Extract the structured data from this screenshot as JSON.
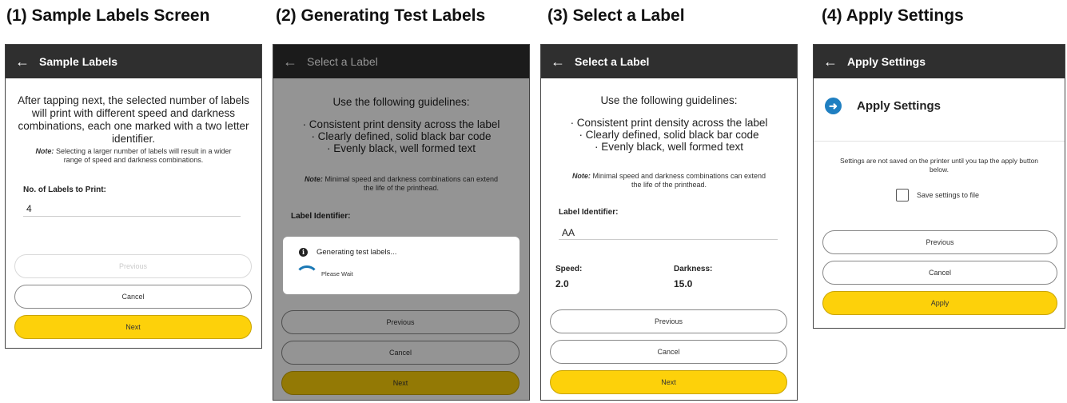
{
  "captions": {
    "c1": "(1) Sample Labels Screen",
    "c2": "(2) Generating Test Labels",
    "c3": "(3) Select a Label",
    "c4": "(4) Apply Settings"
  },
  "icons": {
    "back": "arrow-left-icon",
    "info": "info-icon",
    "next_step": "arrow-right-circle-icon"
  },
  "colors": {
    "appbar": "#2f2f2f",
    "primary_button": "#fdd10a",
    "accent": "#1f7fc1"
  },
  "screen1": {
    "title": "Sample Labels",
    "body_lines": [
      "After tapping next, the selected number of labels",
      "will print with different speed and darkness",
      "combinations, each one marked with a two letter",
      "identifier."
    ],
    "note_label": "Note:",
    "note_lines": [
      " Selecting a larger number of labels will result in a wider",
      "range of speed and darkness combinations."
    ],
    "count_label": "No. of Labels to Print:",
    "count_value": "4",
    "previous": "Previous",
    "cancel": "Cancel",
    "next": "Next"
  },
  "screen2": {
    "title": "Select a Label",
    "guidelines_title": "Use the following guidelines:",
    "guidelines": [
      "· Consistent print density across the label",
      "· Clearly defined, solid black bar code",
      "· Evenly black, well formed text"
    ],
    "note_label": "Note:",
    "note_lines": [
      " Minimal speed and darkness combinations can extend",
      "the life of the printhead."
    ],
    "identifier_label": "Label Identifier:",
    "dialog_message": "Generating test labels...",
    "dialog_wait": "Please Wait",
    "previous": "Previous",
    "cancel": "Cancel",
    "next": "Next"
  },
  "screen3": {
    "title": "Select a Label",
    "guidelines_title": "Use the following guidelines:",
    "guidelines": [
      "· Consistent print density across the label",
      "· Clearly defined, solid black bar code",
      "· Evenly black, well formed text"
    ],
    "note_label": "Note:",
    "note_lines": [
      " Minimal speed and darkness combinations can extend",
      "the life of the printhead."
    ],
    "identifier_label": "Label Identifier:",
    "identifier_value": "AA",
    "speed_label": "Speed:",
    "speed_value": "2.0",
    "darkness_label": "Darkness:",
    "darkness_value": "15.0",
    "previous": "Previous",
    "cancel": "Cancel",
    "next": "Next"
  },
  "screen4": {
    "title": "Apply Settings",
    "heading": "Apply Settings",
    "message_lines": [
      "Settings are not saved on the printer until you tap the apply button",
      "below."
    ],
    "save_label": "Save settings to file",
    "save_checked": false,
    "previous": "Previous",
    "cancel": "Cancel",
    "apply": "Apply"
  }
}
